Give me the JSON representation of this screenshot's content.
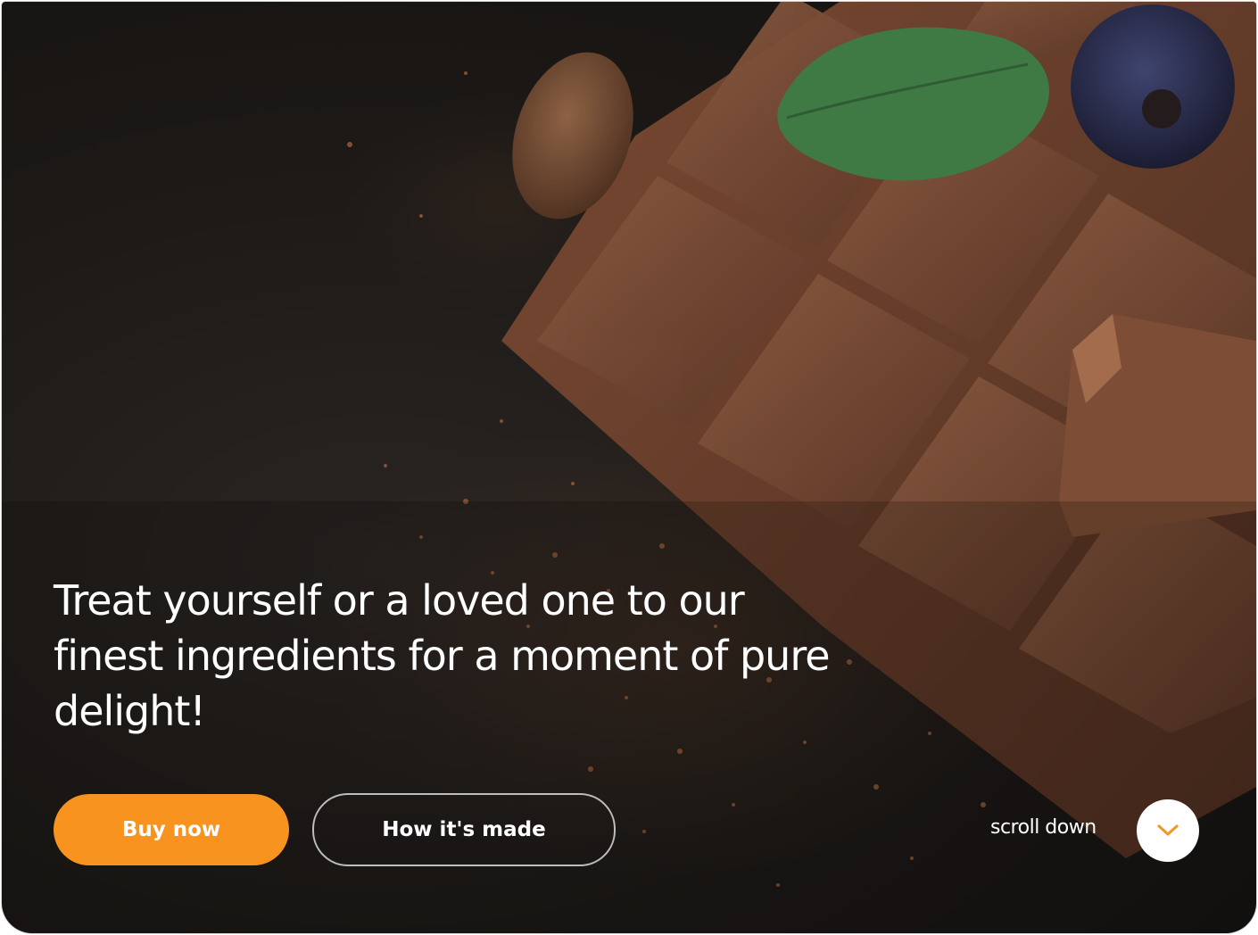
{
  "hero": {
    "headline": "Treat yourself or a loved one to our finest ingredients for a moment of pure delight!",
    "primary_button_label": "Buy now",
    "secondary_button_label": "How it's made",
    "scroll_label": "scroll down"
  },
  "theme": {
    "accent": "#f7931e",
    "background": "#1b1816",
    "chocolate": "#6b4230",
    "text": "#ffffff"
  },
  "icons": {
    "scroll": "chevron-down-icon"
  }
}
